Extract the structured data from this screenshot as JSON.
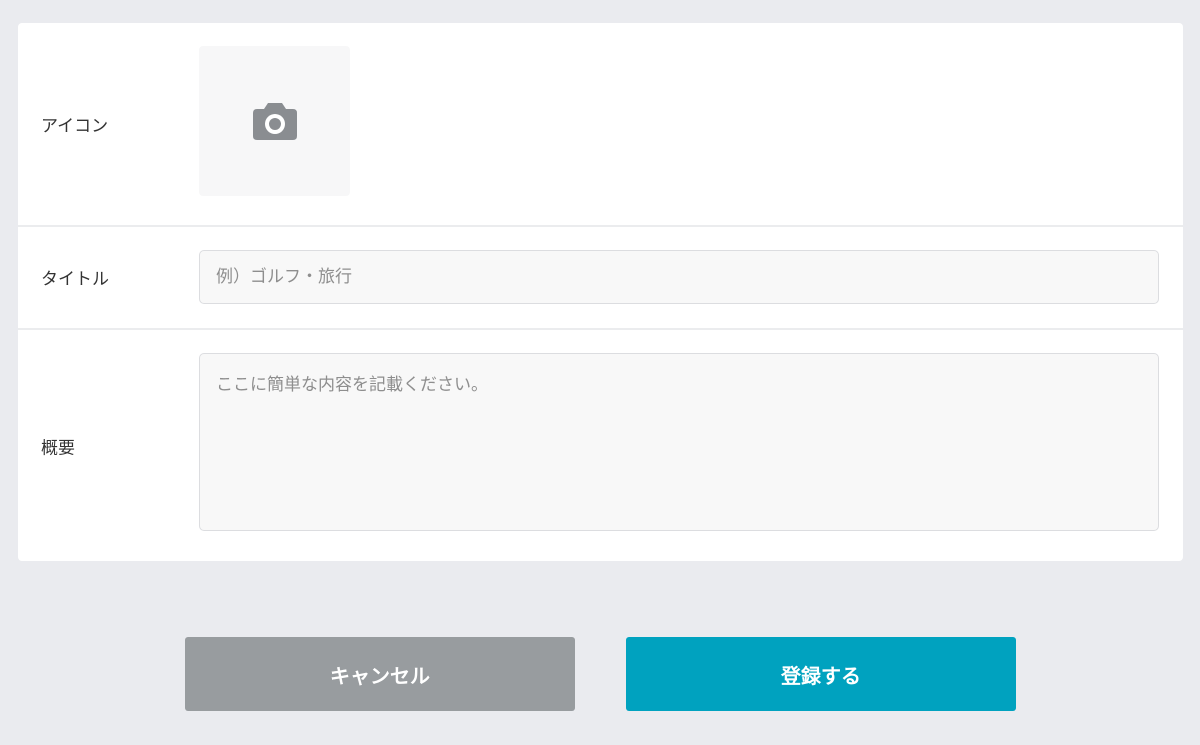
{
  "form": {
    "icon_label": "アイコン",
    "icon_picker": {
      "icon": "camera-icon"
    },
    "title_label": "タイトル",
    "title_input": {
      "value": "",
      "placeholder": "例）ゴルフ・旅行"
    },
    "summary_label": "概要",
    "summary_textarea": {
      "value": "",
      "placeholder": "ここに簡単な内容を記載ください。"
    }
  },
  "actions": {
    "cancel_label": "キャンセル",
    "submit_label": "登録する"
  },
  "colors": {
    "background": "#eaebef",
    "cancel_button": "#989c9f",
    "submit_button": "#00a2bf",
    "icon": "#8a8d91"
  }
}
